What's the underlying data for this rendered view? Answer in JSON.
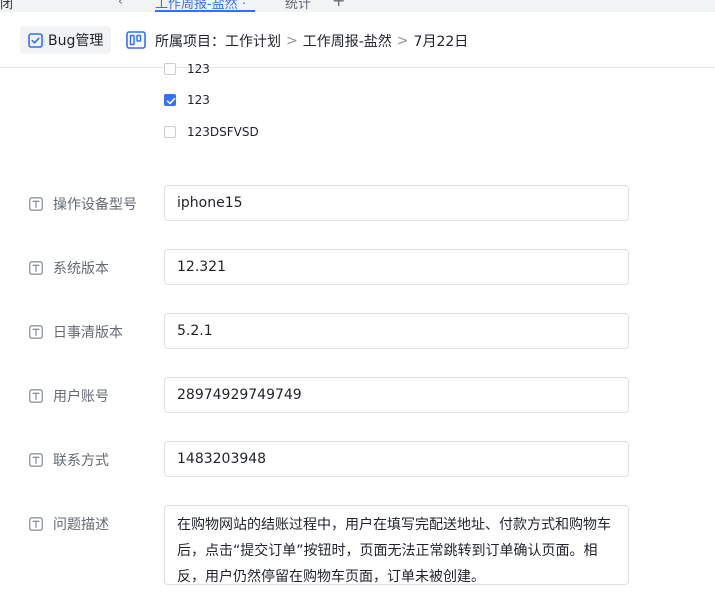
{
  "top_strip": {
    "left_text": "闭",
    "chevron": "‹",
    "active_tab": "工作周报-盐然 ·",
    "stat_tab": "统计",
    "plus": "+"
  },
  "header": {
    "bug_tab_label": "Bug管理",
    "breadcrumb": {
      "prefix": "所属项目：",
      "items": [
        "工作计划",
        "工作周报-盐然",
        "7月22日"
      ],
      "separator": ">"
    }
  },
  "checkbox_options": [
    {
      "label": "123",
      "checked": false
    },
    {
      "label": "123",
      "checked": true
    },
    {
      "label": "123DSFVSD",
      "checked": false
    }
  ],
  "fields": [
    {
      "label": "操作设备型号",
      "value": "iphone15"
    },
    {
      "label": "系统版本",
      "value": "12.321"
    },
    {
      "label": "日事清版本",
      "value": "5.2.1"
    },
    {
      "label": "用户账号",
      "value": "28974929749749"
    },
    {
      "label": "联系方式",
      "value": "1483203948"
    }
  ],
  "description": {
    "label": "问题描述",
    "value": "在购物网站的结账过程中，用户在填写完配送地址、付款方式和购物车后，点击“提交订单”按钮时，页面无法正常跳转到订单确认页面。相反，用户仍然停留在购物车页面，订单未被创建。"
  },
  "colors": {
    "accent": "#3370ff",
    "label_text": "#646a73",
    "border": "#dee0e3"
  },
  "icons": {
    "bug_tab": "checkbox-icon",
    "project": "kanban-icon",
    "field_type": "text-field-icon"
  }
}
